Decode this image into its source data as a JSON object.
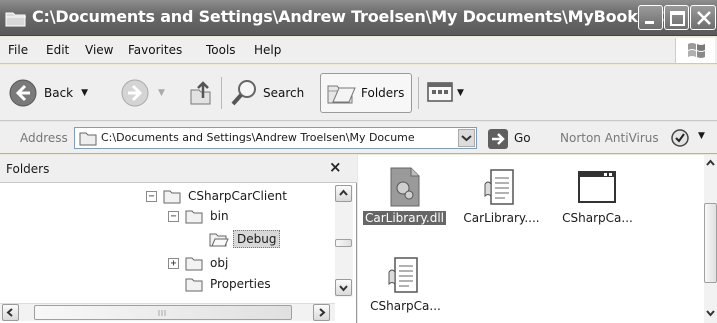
{
  "window": {
    "title": "C:\\Documents and Settings\\Andrew Troelsen\\My Documents\\MyBooks\\C#..."
  },
  "menu": {
    "items": [
      "File",
      "Edit",
      "View",
      "Favorites",
      "Tools",
      "Help"
    ]
  },
  "toolbar": {
    "back_label": "Back",
    "search_label": "Search",
    "folders_label": "Folders"
  },
  "address": {
    "label": "Address",
    "value": "C:\\Documents and Settings\\Andrew Troelsen\\My Docume",
    "go_label": "Go",
    "norton_label": "Norton AntiVirus"
  },
  "folders_pane": {
    "title": "Folders",
    "close_glyph": "×",
    "tree": [
      {
        "label": "CSharpCarClient",
        "expander": "⊟",
        "level": 0
      },
      {
        "label": "bin",
        "expander": "⊟",
        "level": 1
      },
      {
        "label": "Debug",
        "expander": "",
        "level": 2,
        "selected": true
      },
      {
        "label": "obj",
        "expander": "⊞",
        "level": 1
      },
      {
        "label": "Properties",
        "expander": "",
        "level": 1
      }
    ]
  },
  "files": [
    {
      "label": "CarLibrary.dll",
      "icon": "dll-gear-icon",
      "selected": true
    },
    {
      "label": "CarLibrary....",
      "icon": "config-scroll-icon",
      "selected": false
    },
    {
      "label": "CSharpCa...",
      "icon": "exe-window-icon",
      "selected": false
    },
    {
      "label": "CSharpCa...",
      "icon": "config-scroll-icon",
      "selected": false
    }
  ],
  "colors": {
    "title_bar": "#6a6a6a",
    "chrome": "#efefef",
    "selection": "#666666"
  }
}
